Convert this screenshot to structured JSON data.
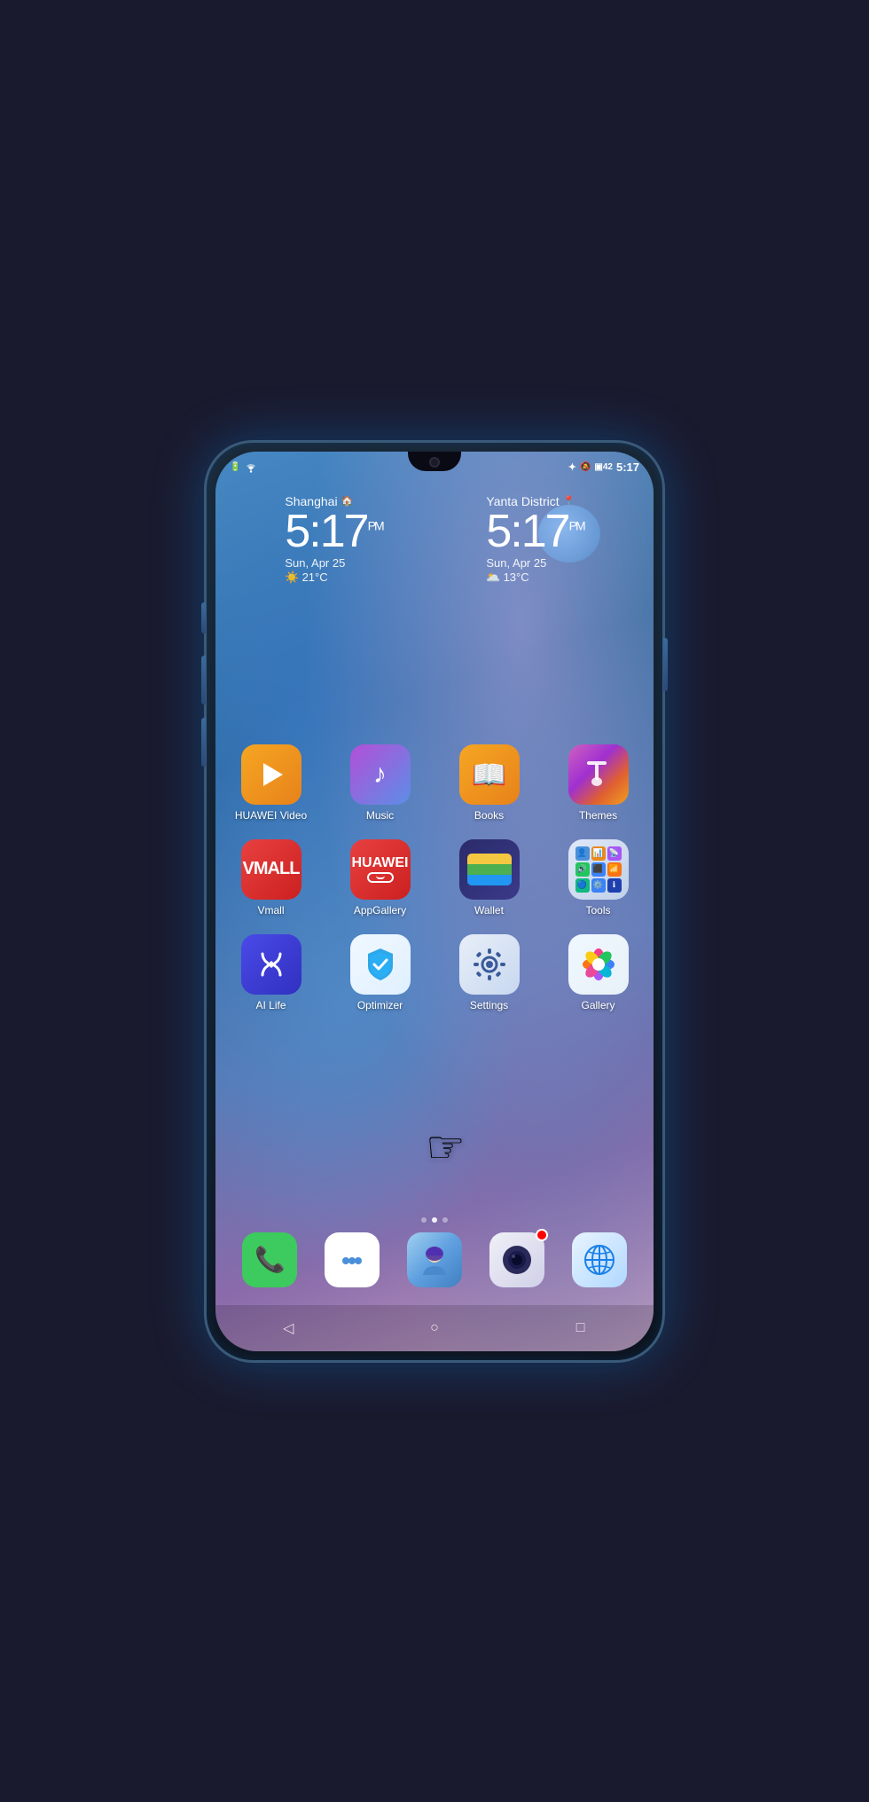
{
  "phone": {
    "status_bar": {
      "time": "5:17",
      "battery": "42",
      "left_icons": [
        "sim-icon",
        "wifi-icon"
      ]
    },
    "clock_left": {
      "city": "Shanghai",
      "time": "5:17",
      "ampm": "PM",
      "date": "Sun, Apr 25",
      "weather_icon": "☀️",
      "temp": "21°C"
    },
    "clock_right": {
      "city": "Yanta District",
      "time": "5:17",
      "ampm": "PM",
      "date": "Sun, Apr 25",
      "weather_icon": "🌥️",
      "temp": "13°C"
    },
    "apps_row1": [
      {
        "id": "huawei-video",
        "label": "HUAWEI Video",
        "icon_class": "icon-huawei-video"
      },
      {
        "id": "music",
        "label": "Music",
        "icon_class": "icon-music"
      },
      {
        "id": "books",
        "label": "Books",
        "icon_class": "icon-books"
      },
      {
        "id": "themes",
        "label": "Themes",
        "icon_class": "icon-themes"
      }
    ],
    "apps_row2": [
      {
        "id": "vmall",
        "label": "Vmall",
        "icon_class": "icon-vmall"
      },
      {
        "id": "appgallery",
        "label": "AppGallery",
        "icon_class": "icon-appgallery"
      },
      {
        "id": "wallet",
        "label": "Wallet",
        "icon_class": "icon-wallet"
      },
      {
        "id": "tools",
        "label": "Tools",
        "icon_class": "icon-tools"
      }
    ],
    "apps_row3": [
      {
        "id": "ailife",
        "label": "AI Life",
        "icon_class": "icon-ailife"
      },
      {
        "id": "optimizer",
        "label": "Optimizer",
        "icon_class": "icon-optimizer"
      },
      {
        "id": "settings",
        "label": "Settings",
        "icon_class": "icon-settings"
      },
      {
        "id": "gallery",
        "label": "Gallery",
        "icon_class": "icon-gallery"
      }
    ],
    "dock": [
      {
        "id": "phone",
        "icon_class": "icon-phone"
      },
      {
        "id": "messages",
        "icon_class": "icon-messages"
      },
      {
        "id": "support",
        "icon_class": "icon-support"
      },
      {
        "id": "camera",
        "icon_class": "icon-camera"
      },
      {
        "id": "browser",
        "icon_class": "icon-browser"
      }
    ],
    "nav": {
      "back": "◁",
      "home": "○",
      "recent": "□"
    },
    "page_dots": [
      0,
      1,
      2
    ],
    "active_dot": 1
  }
}
